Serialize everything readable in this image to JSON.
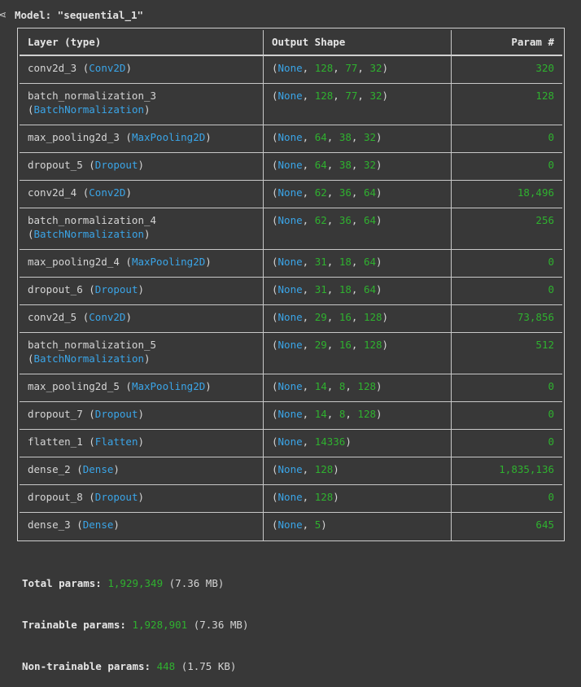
{
  "model": {
    "title": "Model: \"sequential_1\""
  },
  "table": {
    "headers": {
      "layer": "Layer (type)",
      "output": "Output Shape",
      "params": "Param #"
    },
    "rows": [
      {
        "name": "conv2d_3",
        "cls": "Conv2D",
        "wrap": false,
        "shape": [
          "None",
          "128",
          "77",
          "32"
        ],
        "params": "320"
      },
      {
        "name": "batch_normalization_3",
        "cls": "BatchNormalization",
        "wrap": true,
        "shape": [
          "None",
          "128",
          "77",
          "32"
        ],
        "params": "128"
      },
      {
        "name": "max_pooling2d_3",
        "cls": "MaxPooling2D",
        "wrap": false,
        "shape": [
          "None",
          "64",
          "38",
          "32"
        ],
        "params": "0"
      },
      {
        "name": "dropout_5",
        "cls": "Dropout",
        "wrap": false,
        "shape": [
          "None",
          "64",
          "38",
          "32"
        ],
        "params": "0"
      },
      {
        "name": "conv2d_4",
        "cls": "Conv2D",
        "wrap": false,
        "shape": [
          "None",
          "62",
          "36",
          "64"
        ],
        "params": "18,496"
      },
      {
        "name": "batch_normalization_4",
        "cls": "BatchNormalization",
        "wrap": true,
        "shape": [
          "None",
          "62",
          "36",
          "64"
        ],
        "params": "256"
      },
      {
        "name": "max_pooling2d_4",
        "cls": "MaxPooling2D",
        "wrap": false,
        "shape": [
          "None",
          "31",
          "18",
          "64"
        ],
        "params": "0"
      },
      {
        "name": "dropout_6",
        "cls": "Dropout",
        "wrap": false,
        "shape": [
          "None",
          "31",
          "18",
          "64"
        ],
        "params": "0"
      },
      {
        "name": "conv2d_5",
        "cls": "Conv2D",
        "wrap": false,
        "shape": [
          "None",
          "29",
          "16",
          "128"
        ],
        "params": "73,856"
      },
      {
        "name": "batch_normalization_5",
        "cls": "BatchNormalization",
        "wrap": true,
        "shape": [
          "None",
          "29",
          "16",
          "128"
        ],
        "params": "512"
      },
      {
        "name": "max_pooling2d_5",
        "cls": "MaxPooling2D",
        "wrap": false,
        "shape": [
          "None",
          "14",
          "8",
          "128"
        ],
        "params": "0"
      },
      {
        "name": "dropout_7",
        "cls": "Dropout",
        "wrap": false,
        "shape": [
          "None",
          "14",
          "8",
          "128"
        ],
        "params": "0"
      },
      {
        "name": "flatten_1",
        "cls": "Flatten",
        "wrap": false,
        "shape": [
          "None",
          "14336"
        ],
        "params": "0"
      },
      {
        "name": "dense_2",
        "cls": "Dense",
        "wrap": false,
        "shape": [
          "None",
          "128"
        ],
        "params": "1,835,136"
      },
      {
        "name": "dropout_8",
        "cls": "Dropout",
        "wrap": false,
        "shape": [
          "None",
          "128"
        ],
        "params": "0"
      },
      {
        "name": "dense_3",
        "cls": "Dense",
        "wrap": false,
        "shape": [
          "None",
          "5"
        ],
        "params": "645"
      }
    ]
  },
  "totals": {
    "total_label": "Total params:",
    "total_value": "1,929,349",
    "total_size": "(7.36 MB)",
    "trainable_label": "Trainable params:",
    "trainable_value": "1,928,901",
    "trainable_size": "(7.36 MB)",
    "non_trainable_label": "Non-trainable params:",
    "non_trainable_value": "448",
    "non_trainable_size": "(1.75 KB)"
  },
  "colors": {
    "background": "#383838",
    "class_name": "#3aa5e8",
    "number": "#2fb12f",
    "text": "#d5d5d5"
  }
}
